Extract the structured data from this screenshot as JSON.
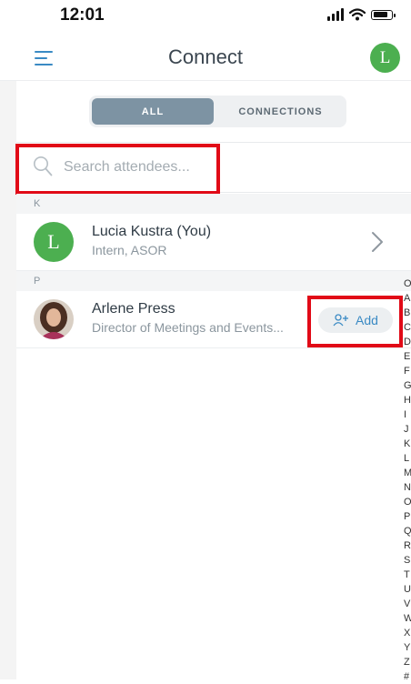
{
  "status_bar": {
    "time": "12:01"
  },
  "header": {
    "title": "Connect",
    "avatar_initial": "L"
  },
  "tabs": [
    {
      "label": "ALL",
      "selected": true
    },
    {
      "label": "CONNECTIONS",
      "selected": false
    }
  ],
  "search": {
    "placeholder": "Search attendees...",
    "value": ""
  },
  "sections": [
    {
      "letter": "K",
      "attendees": [
        {
          "name": "Lucia Kustra (You)",
          "subtitle": "Intern, ASOR",
          "avatar_initial": "L"
        }
      ]
    },
    {
      "letter": "P",
      "attendees": [
        {
          "name": "Arlene Press",
          "subtitle": "Director of Meetings and Events...",
          "action_label": "Add"
        }
      ]
    }
  ],
  "index_letters": [
    "O",
    "A",
    "B",
    "C",
    "D",
    "E",
    "F",
    "G",
    "H",
    "I",
    "J",
    "K",
    "L",
    "M",
    "N",
    "O",
    "P",
    "Q",
    "R",
    "S",
    "T",
    "U",
    "V",
    "W",
    "X",
    "Y",
    "Z",
    "#"
  ],
  "colors": {
    "accent": "#3a8ac4",
    "avatar_green": "#4caf50",
    "highlight_red": "#e10a17",
    "tab_selected": "#7d93a3"
  }
}
